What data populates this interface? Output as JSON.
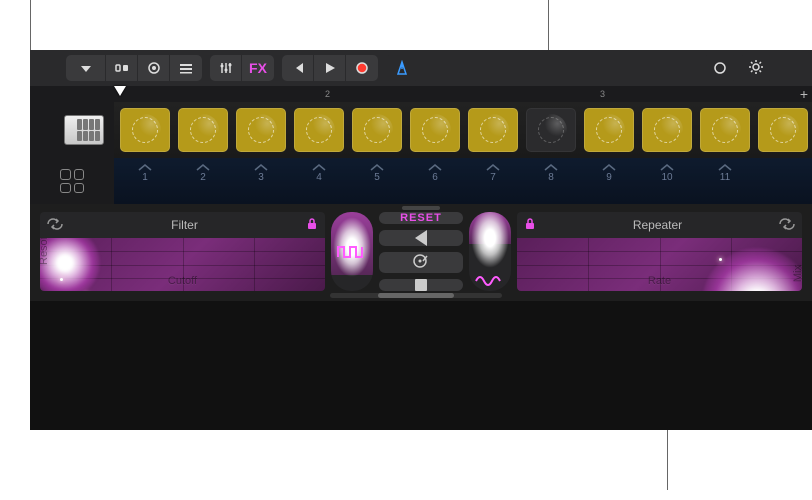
{
  "toolbar": {
    "fx_label": "FX",
    "plus_label": "+"
  },
  "ruler": {
    "marks": [
      {
        "label": "2",
        "pos": 295
      },
      {
        "label": "3",
        "pos": 570
      }
    ]
  },
  "cells": [
    {
      "active": true
    },
    {
      "active": true
    },
    {
      "active": true
    },
    {
      "active": true
    },
    {
      "active": true
    },
    {
      "active": true
    },
    {
      "active": true
    },
    {
      "active": false
    },
    {
      "active": true
    },
    {
      "active": true
    },
    {
      "active": true
    },
    {
      "active": true
    }
  ],
  "triggers": [
    {
      "n": "1"
    },
    {
      "n": "2"
    },
    {
      "n": "3"
    },
    {
      "n": "4"
    },
    {
      "n": "5"
    },
    {
      "n": "6"
    },
    {
      "n": "7"
    },
    {
      "n": "8"
    },
    {
      "n": "9"
    },
    {
      "n": "10"
    },
    {
      "n": "11"
    }
  ],
  "fx": {
    "left": {
      "title": "Filter",
      "xaxis": "Cutoff",
      "yaxis": "Resonance"
    },
    "right": {
      "title": "Repeater",
      "xaxis": "Rate",
      "yaxis": "Mix"
    },
    "reset_label": "RESET"
  }
}
